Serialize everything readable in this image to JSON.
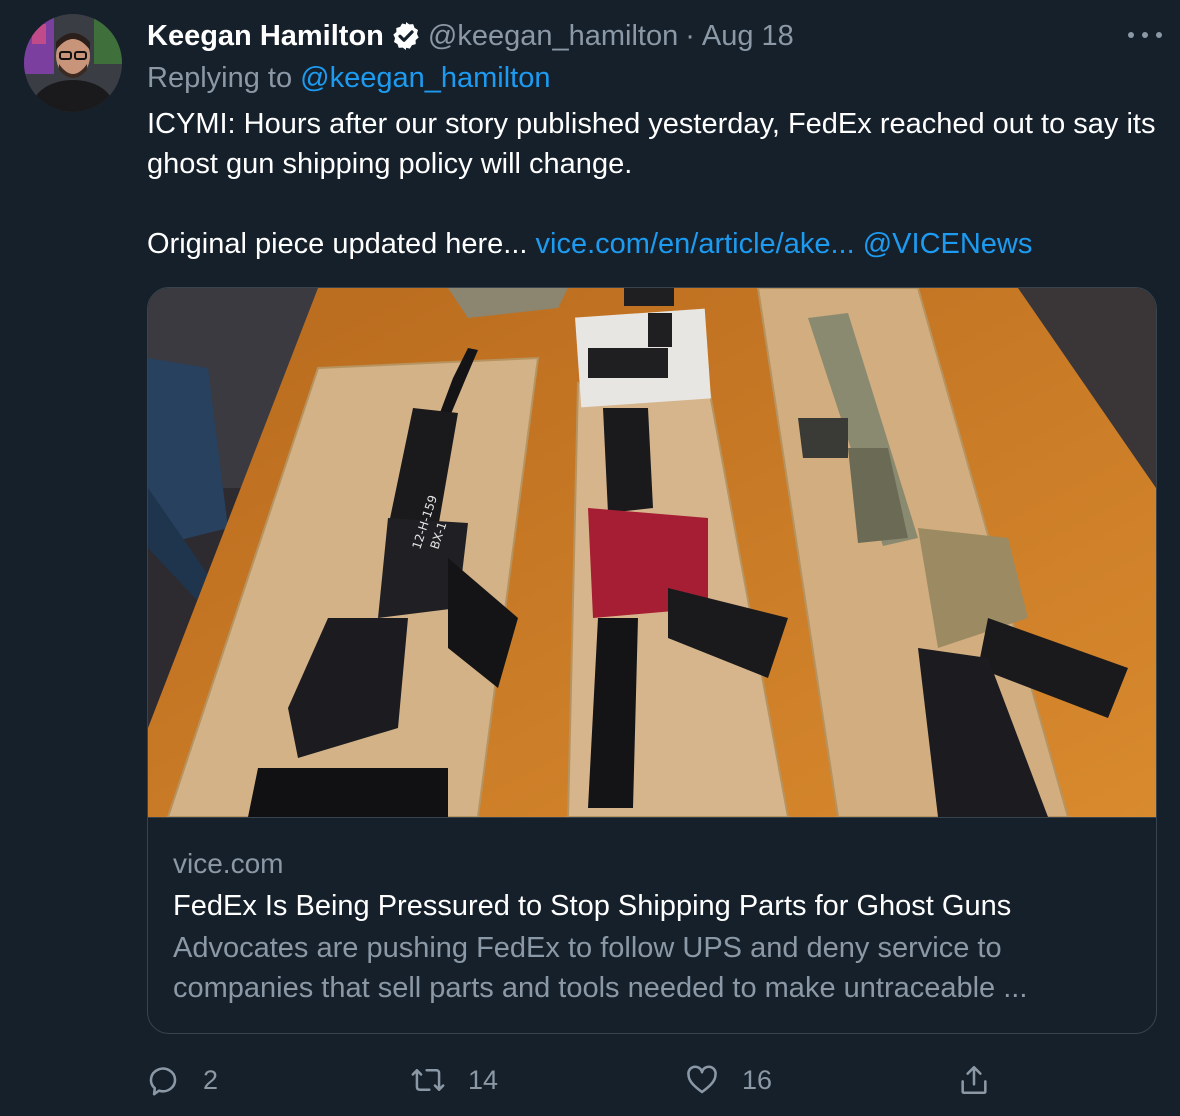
{
  "tweet": {
    "author_name": "Keegan Hamilton",
    "handle": "@keegan_hamilton",
    "separator": "·",
    "date": "Aug 18",
    "replying_prefix": "Replying to ",
    "replying_handle": "@keegan_hamilton",
    "text_line1": "ICYMI: Hours after our story published yesterday, FedEx reached out to say its ghost gun shipping policy will change.",
    "text_line2_prefix": "Original piece updated here... ",
    "text_link": "vice.com/en/article/ake...",
    "text_mention": "@VICENews"
  },
  "card": {
    "domain": "vice.com",
    "title": "FedEx Is Being Pressured to Stop Shipping Parts for Ghost Guns",
    "description": "Advocates are pushing FedEx to follow UPS and deny service to companies that sell parts and tools needed to make untraceable ...",
    "image_labels": {
      "left_receiver_line1": "12-H-159",
      "left_receiver_line2": "BX-1"
    }
  },
  "actions": {
    "replies": "2",
    "retweets": "14",
    "likes": "16"
  },
  "icons": {
    "verified": "verified-badge-icon",
    "more": "more-icon",
    "reply": "reply-icon",
    "retweet": "retweet-icon",
    "like": "heart-icon",
    "share": "share-icon"
  },
  "colors": {
    "background": "#15202b",
    "accent": "#1d9bf0",
    "muted": "#8b98a5",
    "border": "#38444d"
  }
}
